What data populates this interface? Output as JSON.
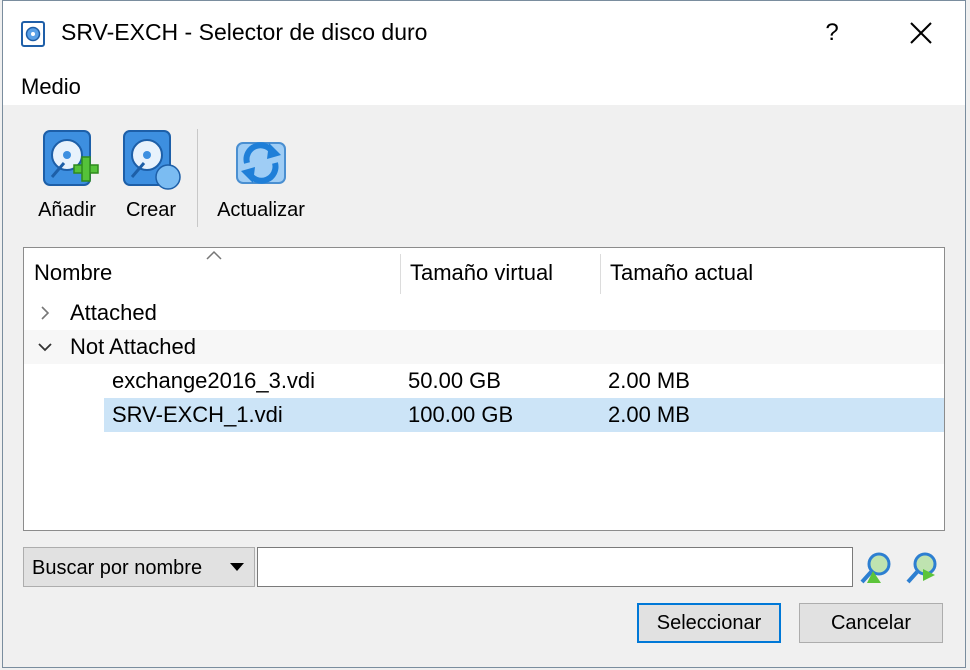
{
  "window": {
    "title": "SRV-EXCH - Selector de disco duro",
    "help_label": "?"
  },
  "menu": {
    "items": [
      "Medio"
    ]
  },
  "toolbar": {
    "add_label": "Añadir",
    "create_label": "Crear",
    "refresh_label": "Actualizar"
  },
  "table": {
    "columns": [
      "Nombre",
      "Tamaño virtual",
      "Tamaño actual"
    ],
    "groups": [
      {
        "label": "Attached",
        "expanded": false
      },
      {
        "label": "Not Attached",
        "expanded": true
      }
    ],
    "rows": [
      {
        "name": "exchange2016_3.vdi",
        "virtual_size": "50.00 GB",
        "actual_size": "2.00 MB",
        "selected": false
      },
      {
        "name": "SRV-EXCH_1.vdi",
        "virtual_size": "100.00 GB",
        "actual_size": "2.00 MB",
        "selected": true
      }
    ]
  },
  "search": {
    "mode_label": "Buscar por nombre",
    "value": ""
  },
  "buttons": {
    "select_label": "Seleccionar",
    "cancel_label": "Cancelar"
  },
  "colors": {
    "selection": "#cce4f7",
    "default_button_border": "#0078d7",
    "icon_blue": "#2d7fd1",
    "icon_green": "#5cc43a"
  },
  "icons": {
    "app": "disk-icon",
    "add": "disk-add-icon",
    "create": "disk-create-icon",
    "refresh": "refresh-icon",
    "search_prev": "search-backward-icon",
    "search_next": "search-forward-icon"
  }
}
